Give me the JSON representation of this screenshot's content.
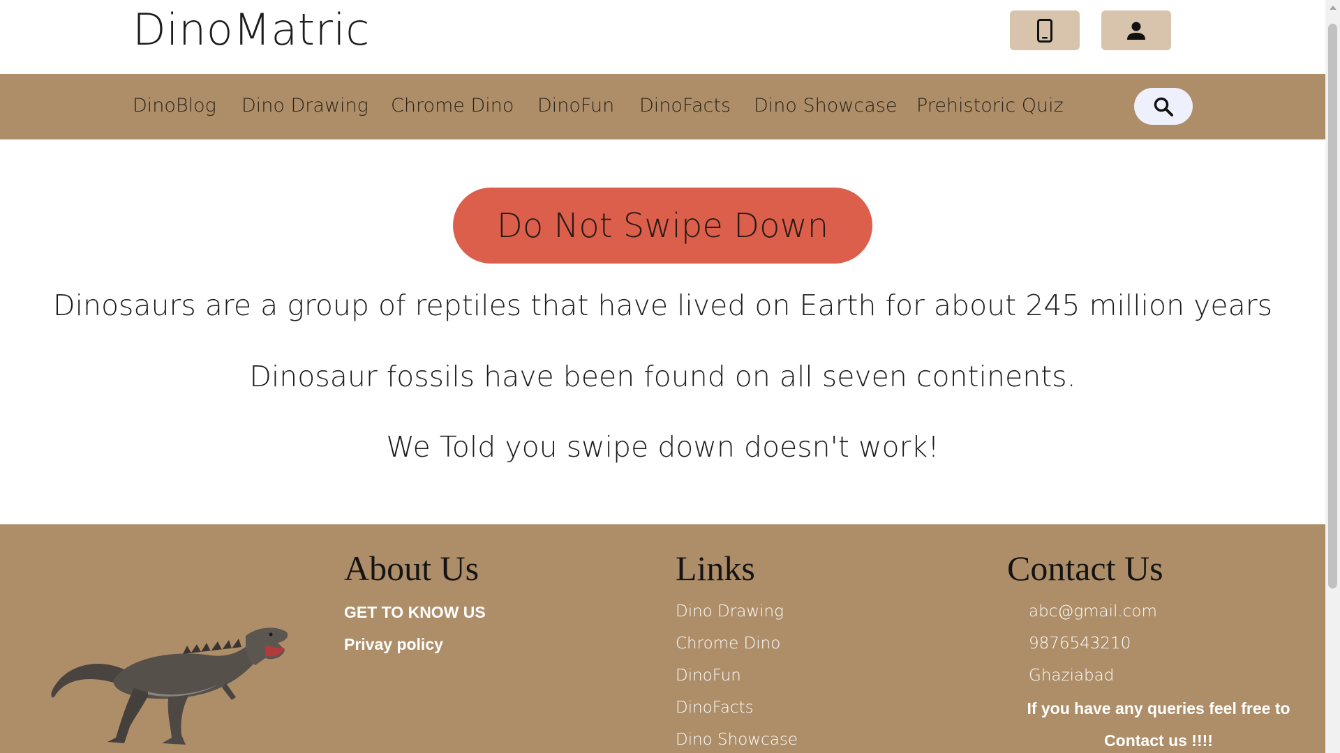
{
  "brand": "DinoMatric",
  "header": {
    "phone_icon": "smartphone-icon",
    "user_icon": "person-icon"
  },
  "nav": {
    "items": [
      "DinoBlog",
      "Dino Drawing",
      "Chrome Dino",
      "DinoFun",
      "DinoFacts",
      "Dino Showcase",
      "Prehistoric Quiz"
    ],
    "search_icon": "search-icon"
  },
  "main": {
    "cta_label": "Do Not Swipe Down",
    "facts": [
      "Dinosaurs are a group of reptiles that have lived on Earth for about 245 million years",
      "Dinosaur fossils have been found on all seven continents.",
      "We Told you swipe down doesn't work!"
    ]
  },
  "footer": {
    "about": {
      "heading": "About Us",
      "items": [
        "GET TO KNOW US",
        "Privay policy"
      ]
    },
    "links": {
      "heading": "Links",
      "items": [
        "Dino Drawing",
        "Chrome Dino",
        "DinoFun",
        "DinoFacts",
        "Dino Showcase"
      ]
    },
    "contact": {
      "heading": "Contact Us",
      "email": "abc@gmail.com",
      "phone": "9876543210",
      "city": "Ghaziabad",
      "note_line1": "If you have any queries feel free to",
      "note_line2": "Contact us !!!!"
    }
  },
  "colors": {
    "accent": "#ad8e68",
    "header_button": "#d8c4ac",
    "cta": "#dc5f4c",
    "search_pill": "#eef0fb"
  }
}
